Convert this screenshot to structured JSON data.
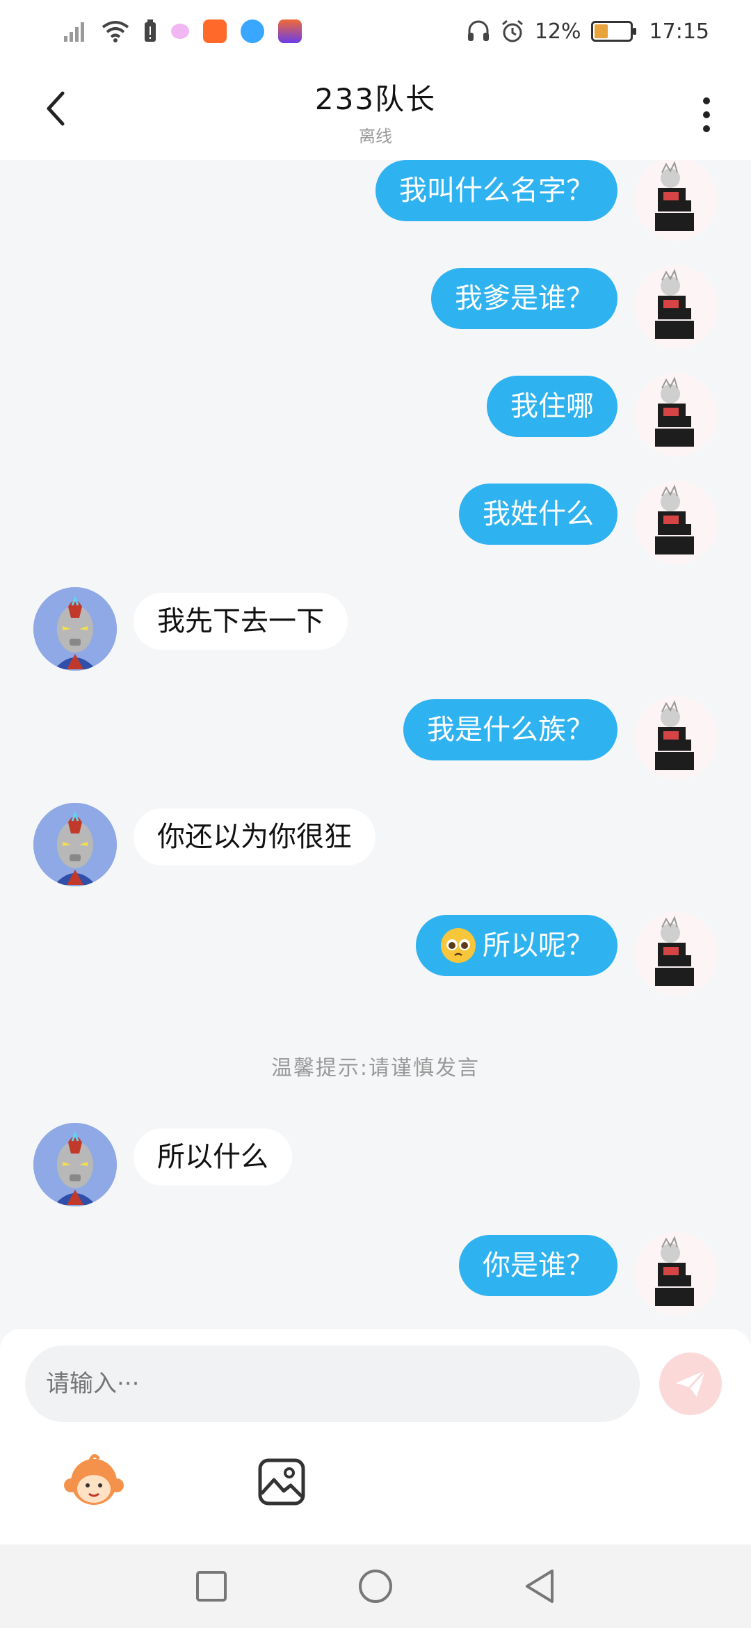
{
  "status_bar": {
    "battery_percent": "12%",
    "time": "17:15",
    "battery_level": 0.12
  },
  "header": {
    "title": "233队长",
    "subtitle": "离线",
    "back_icon": "chevron-left-icon",
    "more_icon": "vertical-dots-icon"
  },
  "messages": [
    {
      "side": "out",
      "text": "我叫什么名字？"
    },
    {
      "side": "out",
      "text": "我爹是谁？"
    },
    {
      "side": "out",
      "text": "我住哪"
    },
    {
      "side": "out",
      "text": "我姓什么"
    },
    {
      "side": "in",
      "text": "我先下去一下"
    },
    {
      "side": "out",
      "text": "我是什么族？"
    },
    {
      "side": "in",
      "text": "你还以为你很狂"
    },
    {
      "side": "out",
      "text": "所以呢？",
      "emoji": "pleading-face"
    },
    {
      "side": "in",
      "text": "所以什么"
    },
    {
      "side": "out",
      "text": "你是谁？"
    }
  ],
  "notice": "温馨提示:请谨慎发言",
  "composer": {
    "placeholder": "请输入···",
    "send_icon": "paper-plane-icon",
    "emoji_icon": "monkey-emoji-icon",
    "image_icon": "image-icon"
  },
  "navbar": {
    "recent_icon": "square-icon",
    "home_icon": "circle-icon",
    "back_icon": "triangle-back-icon"
  },
  "colors": {
    "outgoing_bubble": "#2eb2f0",
    "incoming_bubble": "#ffffff",
    "background": "#f5f6f8"
  }
}
